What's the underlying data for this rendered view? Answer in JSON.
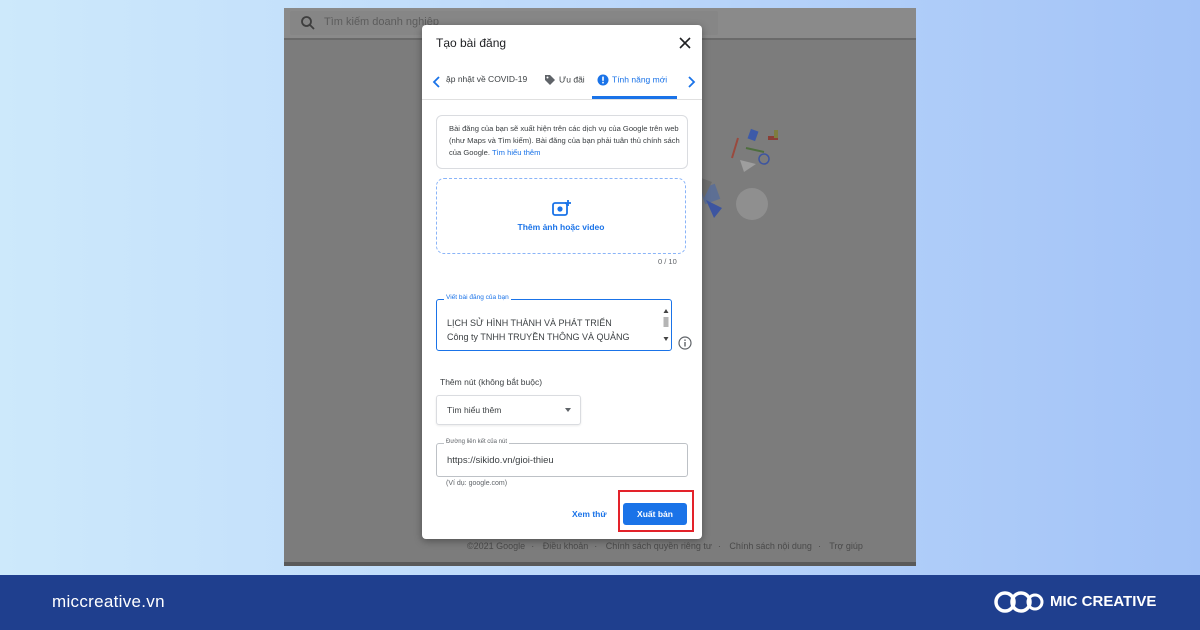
{
  "search": {
    "placeholder": "Tìm kiếm doanh nghiệp"
  },
  "dialog": {
    "title": "Tạo bài đăng",
    "tabs": [
      {
        "label": "ập nhật về COVID-19",
        "icon": "none"
      },
      {
        "label": "Ưu đãi",
        "icon": "tag-icon"
      },
      {
        "label": "Tính năng mới",
        "icon": "alert-circle-icon",
        "active": true
      }
    ],
    "notice": {
      "text": "Bài đăng của bạn sẽ xuất hiện trên các dịch vụ của Google trên web (như Maps và Tìm kiếm). Bài đăng của bạn phải tuân thủ chính sách của Google.",
      "link": "Tìm hiểu thêm"
    },
    "upload": {
      "label": "Thêm ảnh hoặc video",
      "count": "0 / 10"
    },
    "post_text": {
      "label": "Viết bài đăng của bạn",
      "line1": "LỊCH SỬ HÌNH THÀNH VÀ PHÁT TRIỂN",
      "line2": "Công ty TNHH TRUYỀN THÔNG VÀ QUẢNG"
    },
    "add_button": {
      "label": "Thêm nút (không bắt buộc)",
      "selected": "Tìm hiểu thêm"
    },
    "url_field": {
      "label": "Đường liên kết của nút",
      "value": "https://sikido.vn/gioi-thieu",
      "hint": "(Ví dụ: google.com)"
    },
    "actions": {
      "preview": "Xem thử",
      "publish": "Xuất bản"
    }
  },
  "footer": {
    "items": [
      "©2021 Google",
      "Điều khoản",
      "Chính sách quyền riêng tư",
      "Chính sách nội dung",
      "Trợ giúp"
    ]
  },
  "brand": {
    "site": "miccreative.vn",
    "name": "MIC CREATIVE",
    "bar_color": "#1f3f8e"
  },
  "colors": {
    "accent": "#1a73e8",
    "highlight": "#e3222a"
  }
}
